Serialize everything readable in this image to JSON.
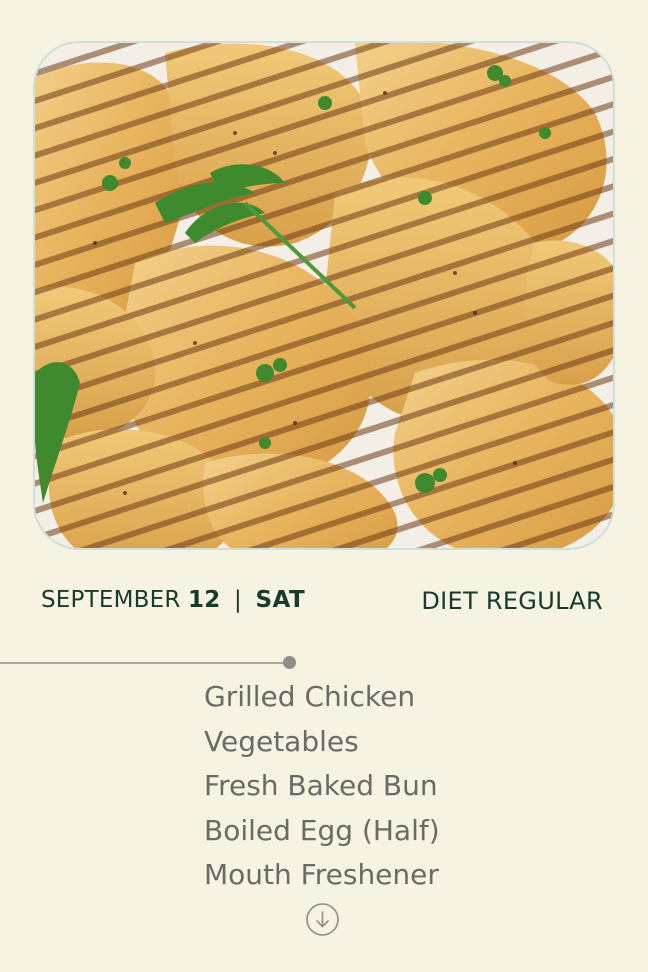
{
  "hero": {
    "image_alt": "Grilled chicken thighs garnished with parsley"
  },
  "meta": {
    "month": "SEPTEMBER",
    "day": "12",
    "separator": "|",
    "weekday": "SAT",
    "diet": "DIET REGULAR"
  },
  "menu": {
    "items": [
      "Grilled Chicken",
      "Vegetables",
      "Fresh Baked Bun",
      "Boiled Egg (Half)",
      "Mouth Freshener"
    ]
  },
  "icons": {
    "scroll": "arrow-down-circle-icon"
  },
  "colors": {
    "background": "#f6f3e3",
    "title_green": "#173b2b",
    "menu_text": "#6b6a64",
    "timeline": "#a8a79e"
  }
}
